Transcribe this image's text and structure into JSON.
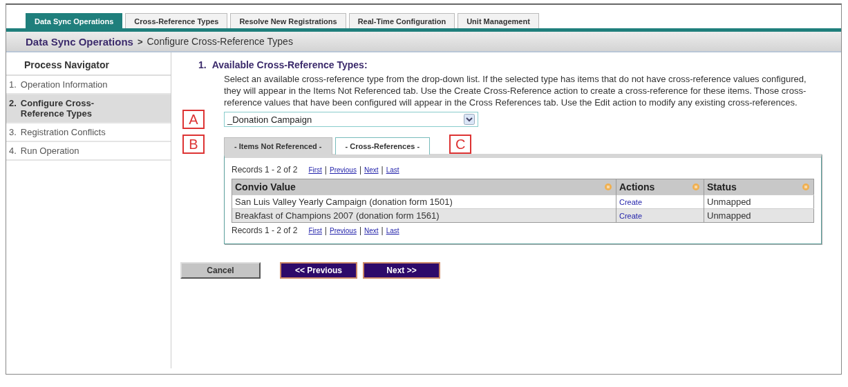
{
  "top_tabs": [
    {
      "label": "Data Sync Operations",
      "selected": true
    },
    {
      "label": "Cross-Reference Types",
      "selected": false
    },
    {
      "label": "Resolve New Registrations",
      "selected": false
    },
    {
      "label": "Real-Time Configuration",
      "selected": false
    },
    {
      "label": "Unit Management",
      "selected": false
    }
  ],
  "breadcrumb": {
    "root": "Data Sync Operations",
    "separator": ">",
    "current": "Configure Cross-Reference Types"
  },
  "process_navigator": {
    "title": "Process Navigator",
    "steps": [
      {
        "number": "1.",
        "label": "Operation Information",
        "selected": false
      },
      {
        "number": "2.",
        "label": "Configure Cross-Reference Types",
        "selected": true
      },
      {
        "number": "3.",
        "label": "Registration Conflicts",
        "selected": false
      },
      {
        "number": "4.",
        "label": "Run Operation",
        "selected": false
      }
    ]
  },
  "section": {
    "number": "1.",
    "heading": "Available Cross-Reference Types:",
    "description": "Select an available cross-reference type from the drop-down list. If the selected type has items that do not have cross-reference values configured, they will appear in the Items Not Referenced tab. Use the Create Cross-Reference action to create a cross-reference for these items. Those cross-reference values that have been configured will appear in the Cross References tab. Use the Edit action to modify any existing cross-references.",
    "type_select": {
      "value": "_Donation Campaign"
    },
    "callouts": [
      "A",
      "B",
      "C"
    ],
    "inner_tabs": [
      {
        "label": "- Items Not Referenced -",
        "selected": true
      },
      {
        "label": "- Cross-References -",
        "selected": false
      }
    ],
    "pager_top": {
      "summary": "Records 1 - 2 of 2",
      "links": [
        "First",
        "Previous",
        "Next",
        "Last"
      ],
      "separator": "|"
    },
    "table": {
      "columns": [
        "Convio Value",
        "Actions",
        "Status"
      ],
      "rows": [
        {
          "cells": [
            "San Luis Valley Yearly Campaign (donation form 1501)",
            "Create",
            "Unmapped"
          ],
          "shaded": false
        },
        {
          "cells": [
            "Breakfast of Champions 2007 (donation form 1561)",
            "Create",
            "Unmapped"
          ],
          "shaded": true
        }
      ]
    },
    "pager_bottom": {
      "summary": "Records 1 - 2 of 2",
      "links": [
        "First",
        "Previous",
        "Next",
        "Last"
      ],
      "separator": "|"
    }
  },
  "buttons": [
    {
      "label": "Cancel",
      "kind": "secondary"
    },
    {
      "label": "<< Previous",
      "kind": "primary"
    },
    {
      "label": "Next >>",
      "kind": "primary"
    }
  ]
}
